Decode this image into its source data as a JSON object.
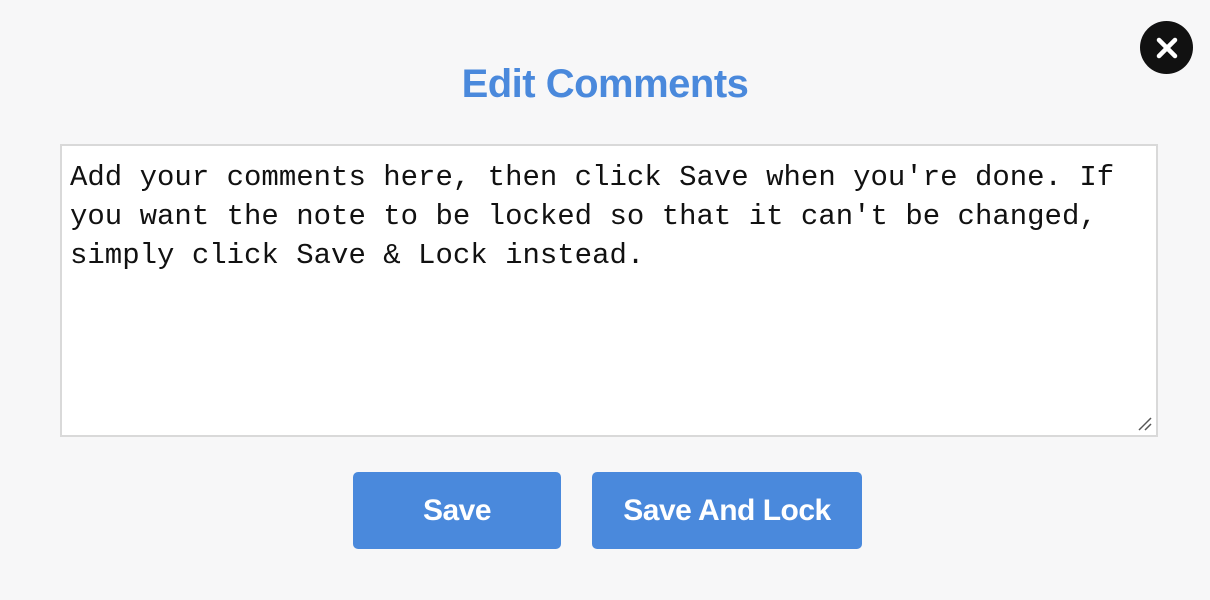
{
  "dialog": {
    "title": "Edit Comments",
    "close_icon": "close-icon"
  },
  "editor": {
    "value": "Add your comments here, then click Save when you're done. If you want the note to be locked so that it can't be changed, simply click Save & Lock instead. "
  },
  "actions": {
    "save_label": "Save",
    "save_lock_label": "Save And Lock"
  },
  "colors": {
    "accent": "#4a89dc",
    "close_bg": "#111111",
    "background": "#f7f7f8"
  }
}
